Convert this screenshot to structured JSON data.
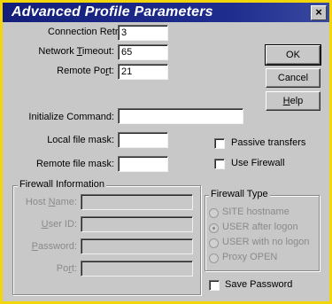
{
  "window": {
    "title": "Advanced Profile Parameters",
    "close_glyph": "×"
  },
  "fields": {
    "connection_retry": {
      "label": "Connection Retry",
      "value": "3"
    },
    "network_timeout": {
      "label_pre": "Network ",
      "label_key": "T",
      "label_post": "imeout:",
      "value": "65"
    },
    "remote_port": {
      "label_pre": "Remote Po",
      "label_key": "r",
      "label_post": "t:",
      "value": "21"
    },
    "initialize_command": {
      "label": "Initialize Command:",
      "value": ""
    },
    "local_file_mask": {
      "label": "Local file mask:",
      "value": ""
    },
    "remote_file_mask": {
      "label": "Remote file mask:",
      "value": ""
    }
  },
  "buttons": {
    "ok": "OK",
    "cancel": "Cancel",
    "help_key": "H",
    "help_rest": "elp"
  },
  "checkboxes": {
    "passive_transfers": {
      "label": "Passive transfers",
      "checked": false
    },
    "use_firewall": {
      "label": "Use Firewall",
      "checked": false
    },
    "save_password": {
      "label": "Save Password",
      "checked": false
    }
  },
  "firewall_info": {
    "title": "Firewall Information",
    "host_name": {
      "label_pre": "Host ",
      "label_key": "N",
      "label_post": "ame:",
      "value": ""
    },
    "user_id": {
      "label_key": "U",
      "label_post": "ser ID:",
      "value": ""
    },
    "password": {
      "label_key": "P",
      "label_post": "assword:",
      "value": ""
    },
    "port": {
      "label_pre": "Po",
      "label_key": "r",
      "label_post": "t:",
      "value": ""
    }
  },
  "firewall_type": {
    "title": "Firewall Type",
    "options": [
      "SITE hostname",
      "USER after logon",
      "USER with no logon",
      "Proxy OPEN"
    ],
    "selected_index": 1
  }
}
